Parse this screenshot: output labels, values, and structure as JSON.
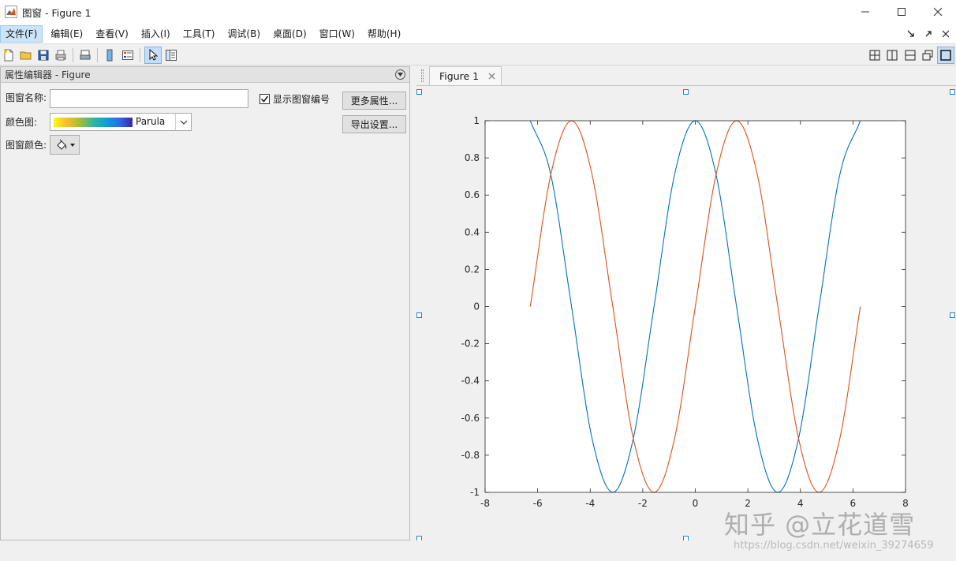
{
  "window": {
    "title": "图窗 - Figure 1"
  },
  "menu": {
    "items": [
      "文件(F)",
      "编辑(E)",
      "查看(V)",
      "插入(I)",
      "工具(T)",
      "调试(B)",
      "桌面(D)",
      "窗口(W)",
      "帮助(H)"
    ]
  },
  "prop_editor": {
    "header": "属性编辑器 - Figure",
    "name_label": "图窗名称:",
    "name_value": "",
    "show_number_label": "显示图窗编号",
    "show_number_checked": true,
    "more_props_button": "更多属性...",
    "colormap_label": "颜色图:",
    "colormap_value": "Parula",
    "export_button": "导出设置...",
    "figcolor_label": "图窗颜色:"
  },
  "figure_tab": {
    "label": "Figure 1"
  },
  "colors": {
    "series1": "#0072bd",
    "series2": "#d95319"
  },
  "chart_data": {
    "type": "line",
    "title": "",
    "xlabel": "",
    "ylabel": "",
    "xlim": [
      -8,
      8
    ],
    "ylim": [
      -1,
      1
    ],
    "xticks": [
      -8,
      -6,
      -4,
      -2,
      0,
      2,
      4,
      6,
      8
    ],
    "yticks": [
      -1,
      -0.8,
      -0.6,
      -0.4,
      -0.2,
      0,
      0.2,
      0.4,
      0.6,
      0.8,
      1
    ],
    "ytick_labels": [
      "-1",
      "-0.8",
      "-0.6",
      "-0.4",
      "-0.2",
      "0",
      "0.2",
      "0.4",
      "0.6",
      "0.8",
      "1"
    ],
    "grid": false,
    "series": [
      {
        "color": "#0072bd",
        "x": [
          -6.28,
          -5.5,
          -4.71,
          -3.93,
          -3.14,
          -2.36,
          -1.57,
          -0.79,
          0,
          0.79,
          1.57,
          2.36,
          3.14,
          3.93,
          4.71,
          5.5,
          6.28
        ],
        "y": [
          1,
          0.71,
          0,
          -0.71,
          -1,
          -0.71,
          0,
          0.71,
          1,
          0.71,
          0,
          -0.71,
          -1,
          -0.71,
          0,
          0.71,
          1
        ]
      },
      {
        "color": "#d95319",
        "x": [
          -6.28,
          -5.5,
          -4.71,
          -3.93,
          -3.14,
          -2.36,
          -1.57,
          -0.79,
          0,
          0.79,
          1.57,
          2.36,
          3.14,
          3.93,
          4.71,
          5.5,
          6.28
        ],
        "y": [
          0,
          0.71,
          1,
          0.71,
          0,
          -0.71,
          -1,
          -0.71,
          0,
          0.71,
          1,
          0.71,
          0,
          -0.71,
          -1,
          -0.71,
          0
        ]
      }
    ]
  },
  "watermark": {
    "brand": "知乎 @立花道雪",
    "url": "https://blog.csdn.net/weixin_39274659"
  }
}
